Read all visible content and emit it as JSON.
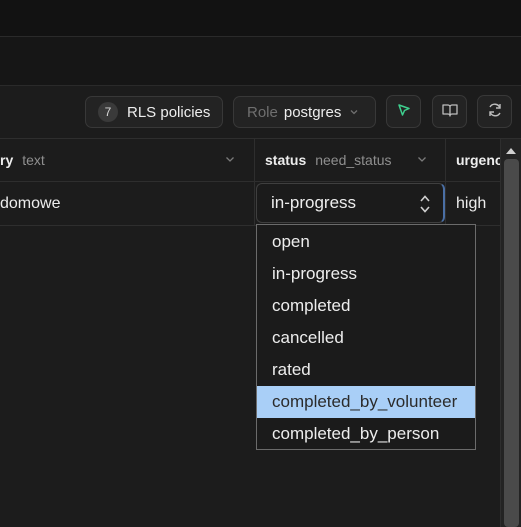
{
  "toolbar": {
    "rls_count": "7",
    "rls_label": "RLS policies",
    "role_label": "Role",
    "role_value": "postgres"
  },
  "columns": [
    {
      "name": "ry",
      "type": "text"
    },
    {
      "name": "status",
      "type": "need_status"
    },
    {
      "name": "urgenc",
      "type": ""
    }
  ],
  "row": {
    "category_value": "domowe",
    "urgency_value": "high"
  },
  "editor": {
    "current_value": "in-progress"
  },
  "dropdown": {
    "options": [
      "open",
      "in-progress",
      "completed",
      "cancelled",
      "rated",
      "completed_by_volunteer",
      "completed_by_person"
    ],
    "highlighted": "completed_by_volunteer"
  },
  "colors": {
    "accent_green": "#3ecf8e",
    "highlight": "#a9cff7"
  },
  "icons": [
    "chevron-down-icon",
    "cursor-arrow-icon",
    "book-open-icon",
    "refresh-icon",
    "up-down-arrows-icon",
    "scroll-up-arrow-icon"
  ]
}
